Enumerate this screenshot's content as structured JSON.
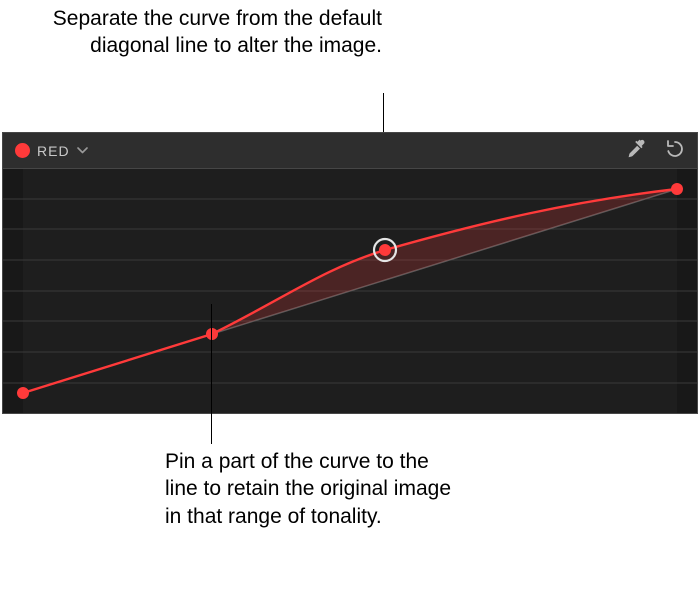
{
  "callouts": {
    "top": "Separate the curve from the default diagonal line to alter the image.",
    "bottom": "Pin a part of the curve to the line to retain the original image in that range of tonality."
  },
  "header": {
    "channel_label": "RED",
    "channel_color": "#ff3a3a",
    "eyedropper_label": "Eyedropper",
    "reset_label": "Reset"
  },
  "colors": {
    "grid": "#3a3a3a",
    "baseline": "#5a5a5a",
    "curve": "#ff3a3a",
    "fill": "rgba(255,58,58,0.22)",
    "panel_dark": "#181818"
  }
}
